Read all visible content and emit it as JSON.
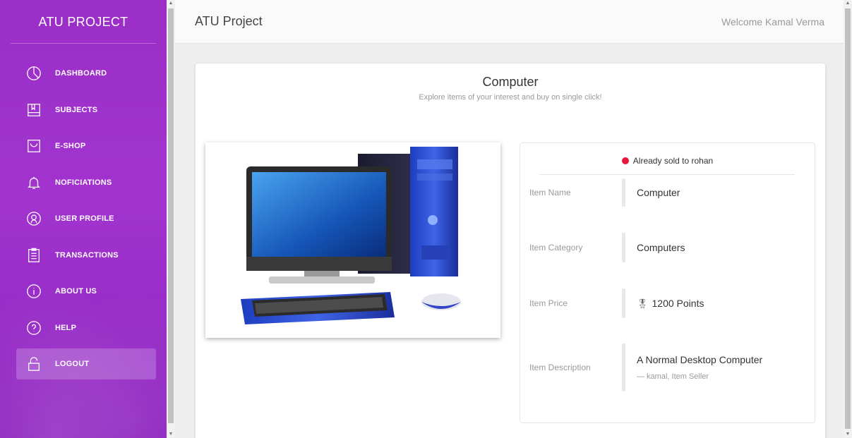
{
  "sidebar": {
    "brand": "ATU PROJECT",
    "items": [
      {
        "label": "DASHBOARD",
        "icon": "dashboard-icon"
      },
      {
        "label": "SUBJECTS",
        "icon": "book-icon"
      },
      {
        "label": "E-SHOP",
        "icon": "bag-icon"
      },
      {
        "label": "NOFICIATIONS",
        "icon": "bell-icon"
      },
      {
        "label": "USER PROFILE",
        "icon": "user-icon"
      },
      {
        "label": "TRANSACTIONS",
        "icon": "clipboard-icon"
      },
      {
        "label": "ABOUT US",
        "icon": "info-icon"
      },
      {
        "label": "HELP",
        "icon": "help-icon"
      },
      {
        "label": "LOGOUT",
        "icon": "lock-icon",
        "active": true
      }
    ]
  },
  "header": {
    "title": "ATU Project",
    "welcome": "Welcome Kamal Verma"
  },
  "product": {
    "title": "Computer",
    "subtitle": "Explore items of your interest and buy on single click!",
    "status": "Already sold to rohan",
    "status_color": "#e8173d",
    "fields": {
      "name_label": "Item Name",
      "name": "Computer",
      "category_label": "Item Category",
      "category": "Computers",
      "price_label": "Item Price",
      "price": "1200 Points",
      "description_label": "Item Description",
      "description": "A Normal Desktop Computer",
      "seller": "— kamal, Item Seller"
    }
  },
  "colors": {
    "sidebar": "#9b2ec7",
    "accent": "#e8173d"
  }
}
